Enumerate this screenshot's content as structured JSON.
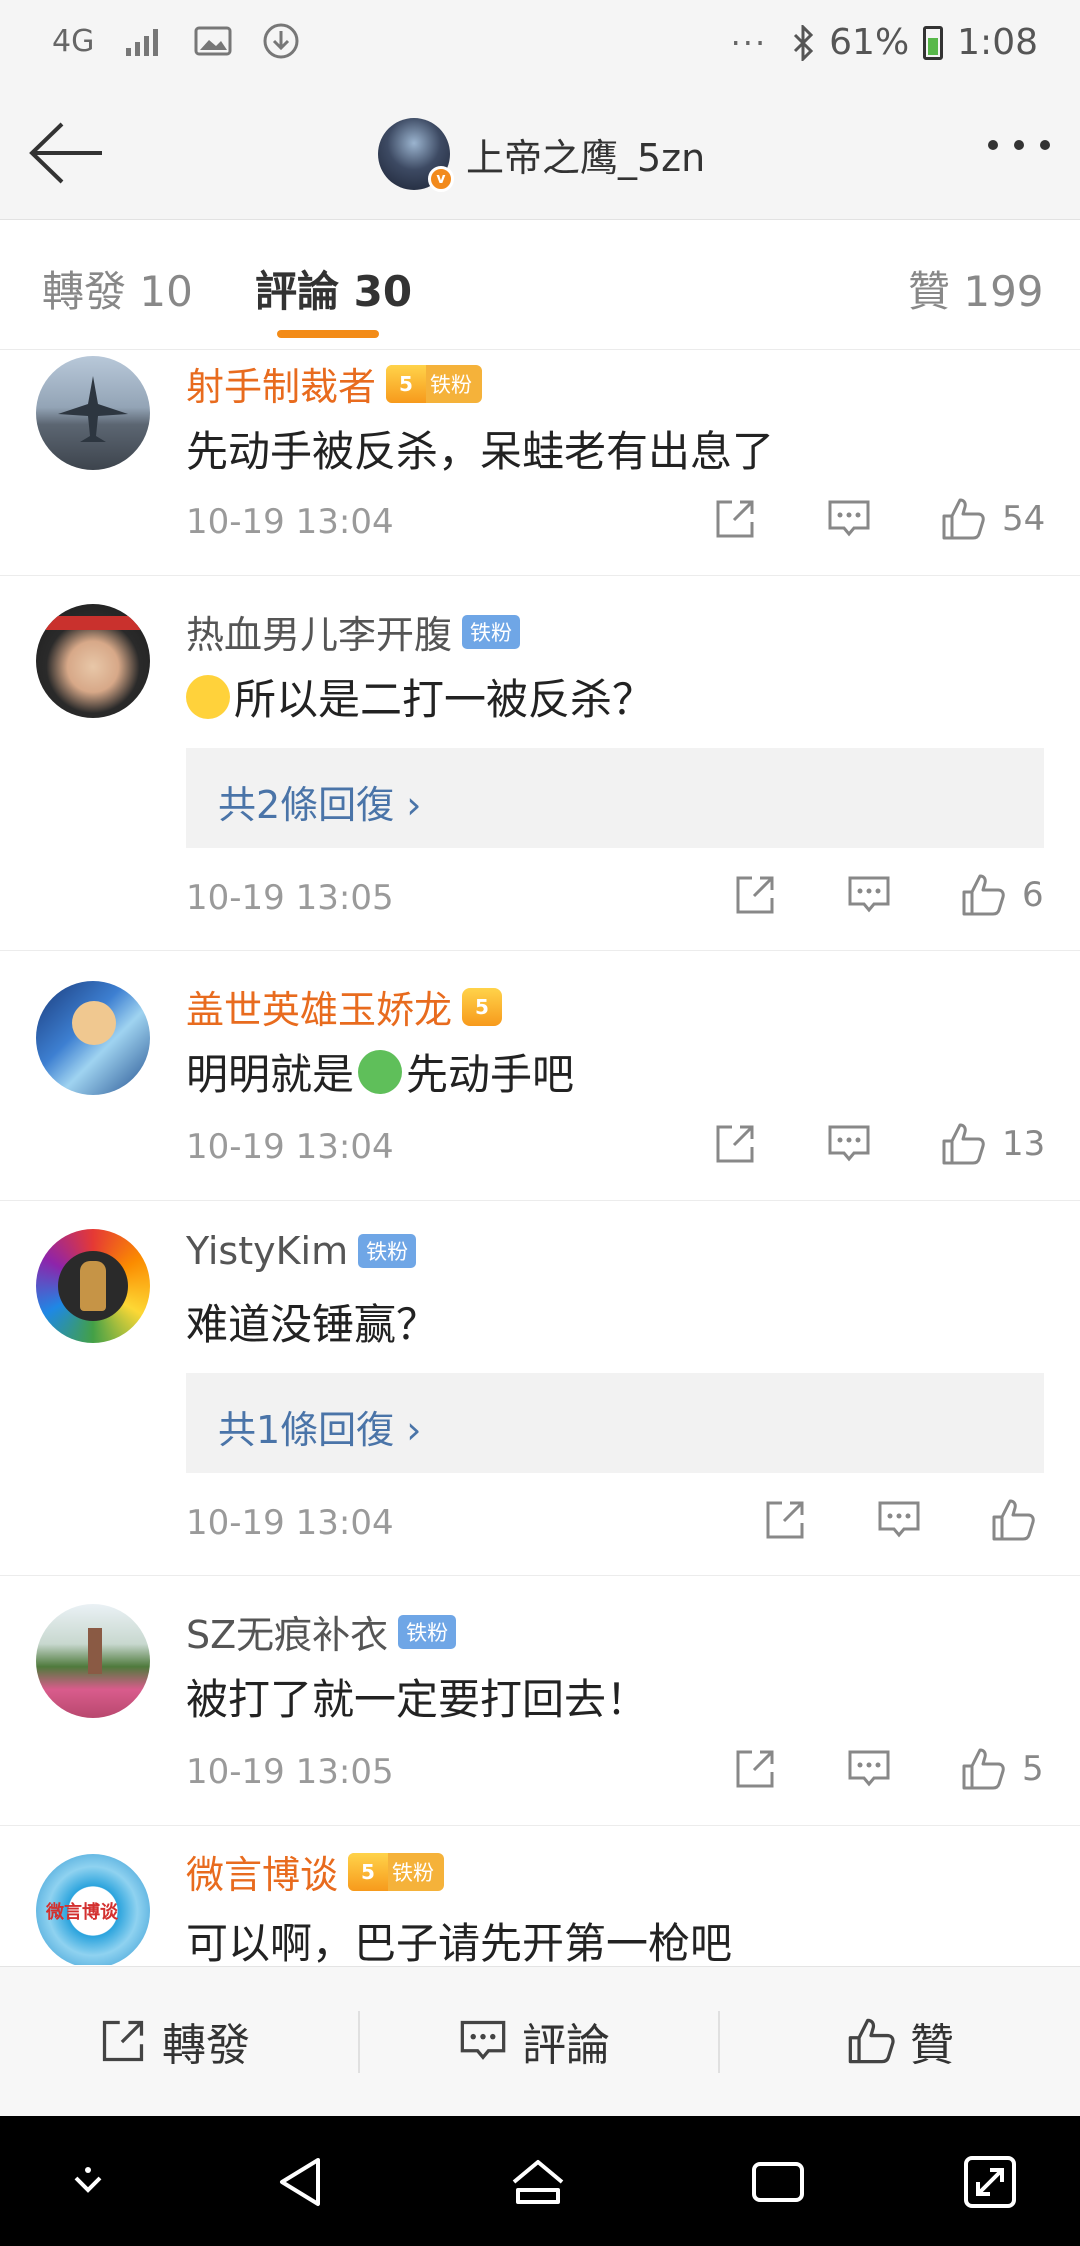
{
  "status_bar": {
    "network": "4G",
    "battery": "61%",
    "time": "1:08",
    "dots": "···"
  },
  "header": {
    "title": "上帝之鹰_5zn",
    "verified": "v"
  },
  "tabs": [
    {
      "label": "轉發 10"
    },
    {
      "label": "評論 30"
    },
    {
      "label": "贊 199"
    }
  ],
  "comments": [
    {
      "name": "射手制裁者",
      "badge": "铁粉",
      "crown_level": "5",
      "text": "先动手被反杀，呆蛙老有出息了",
      "time": "10-19 13:04",
      "likes": "54"
    },
    {
      "name": "热血男儿李开腹",
      "badge": "铁粉",
      "text": "所以是二打一被反杀？",
      "reply": "共2條回復 ›",
      "time": "10-19 13:05",
      "likes": "6"
    },
    {
      "name": "盖世英雄玉娇龙",
      "crown_level": "5",
      "text_before": "明明就是",
      "text_after": "先动手吧",
      "time": "10-19 13:04",
      "likes": "13"
    },
    {
      "name": "YistyKim",
      "badge": "铁粉",
      "text": "难道没锤赢？",
      "reply": "共1條回復 ›",
      "time": "10-19 13:04",
      "likes": ""
    },
    {
      "name": "SZ无痕补衣",
      "badge": "铁粉",
      "text": "被打了就一定要打回去！",
      "time": "10-19 13:05",
      "likes": "5"
    },
    {
      "name": "微言博谈",
      "badge": "铁粉",
      "crown_level": "5",
      "text": "可以啊，巴子请先开第一枪吧",
      "avatar_text": "微言博谈"
    }
  ],
  "bottom_bar": {
    "repost": "轉發",
    "comment": "評論",
    "like": "贊"
  },
  "colors": {
    "accent": "#f38b17",
    "vip_name": "#e86b1e",
    "link": "#4a74a8",
    "fan_badge": "#6fa6e6"
  }
}
